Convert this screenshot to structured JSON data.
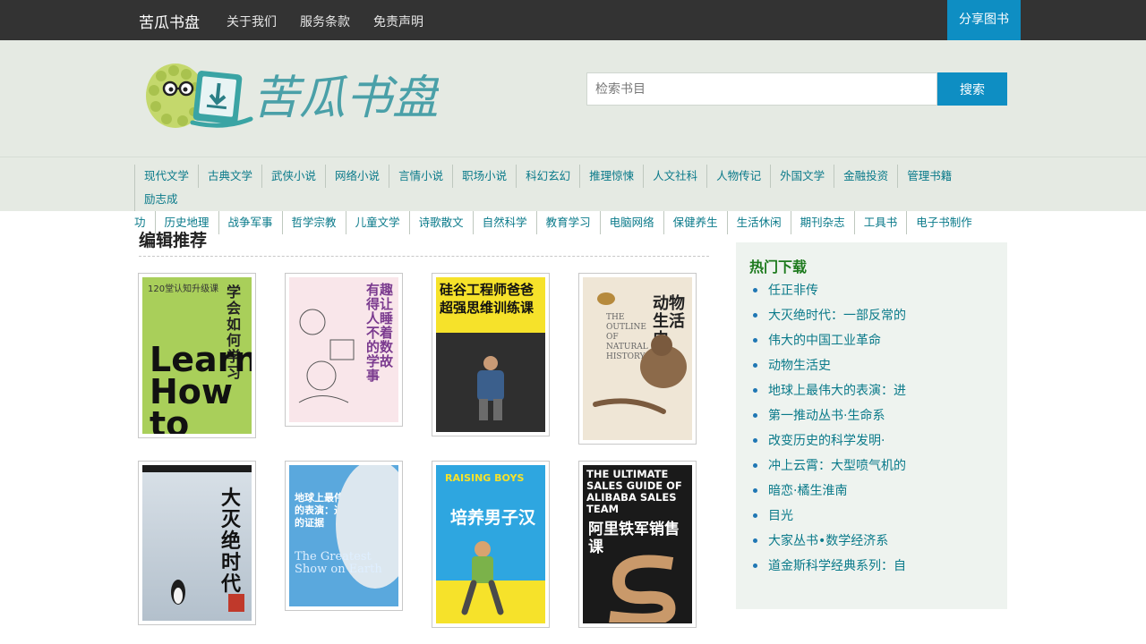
{
  "topbar": {
    "brand": "苦瓜书盘",
    "links": [
      "关于我们",
      "服务条款",
      "免责声明"
    ],
    "share": "分享图书"
  },
  "header": {
    "logo_text": "苦瓜书盘",
    "search_placeholder": "检索书目",
    "search_button": "搜索"
  },
  "categories": {
    "row1": [
      "现代文学",
      "古典文学",
      "武侠小说",
      "网络小说",
      "言情小说",
      "职场小说",
      "科幻玄幻",
      "推理惊悚",
      "人文社科",
      "人物传记",
      "外国文学",
      "金融投资",
      "管理书籍",
      "励志成"
    ],
    "row2": [
      "功",
      "历史地理",
      "战争军事",
      "哲学宗教",
      "儿童文学",
      "诗歌散文",
      "自然科学",
      "教育学习",
      "电脑网络",
      "保健养生",
      "生活休闲",
      "期刊杂志",
      "工具书",
      "电子书制作"
    ]
  },
  "main": {
    "title": "编辑推荐",
    "books": [
      {
        "cover_title": "学会如何学习",
        "cover_sub": "Learn How to Learn",
        "cover_tag": "120堂认知升级课",
        "bg": "#a9cf5a"
      },
      {
        "cover_title": "有趣得让人睡不着的数学故事",
        "cover_sub": "",
        "cover_tag": "",
        "bg": "#f7e2e6"
      },
      {
        "cover_title": "硅谷工程师爸爸超强思维训练课",
        "cover_sub": "",
        "cover_tag": "",
        "bg": "#2f2f2f"
      },
      {
        "cover_title": "动物生活史",
        "cover_sub": "THE OUTLINE OF NATURAL HISTORY",
        "cover_tag": "",
        "bg": "#efe6d6"
      },
      {
        "cover_title": "大灭绝时代",
        "cover_sub": "",
        "cover_tag": "",
        "bg": "#c9d3dd"
      },
      {
        "cover_title": "地球上最伟大的表演：进化的证据",
        "cover_sub": "The Greatest Show on Earth",
        "cover_tag": "",
        "bg": "#5aa8dd"
      },
      {
        "cover_title": "培养男子汉",
        "cover_sub": "RAISING BOYS",
        "cover_tag": "",
        "bg": "#2ea6e0"
      },
      {
        "cover_title": "阿里铁军销售课",
        "cover_sub": "THE ULTIMATE SALES GUIDE OF ALIBABA SALES TEAM",
        "cover_tag": "",
        "bg": "#1a1a1a"
      }
    ]
  },
  "sidebar": {
    "title": "热门下载",
    "items": [
      "任正非传",
      "大灭绝时代：一部反常的",
      "伟大的中国工业革命",
      "动物生活史",
      "地球上最伟大的表演：进",
      "第一推动丛书·生命系",
      "改变历史的科学发明·",
      "冲上云霄：大型喷气机的",
      "暗恋·橘生淮南",
      "目光",
      "大家丛书•数学经济系",
      "道金斯科学经典系列：自"
    ]
  }
}
